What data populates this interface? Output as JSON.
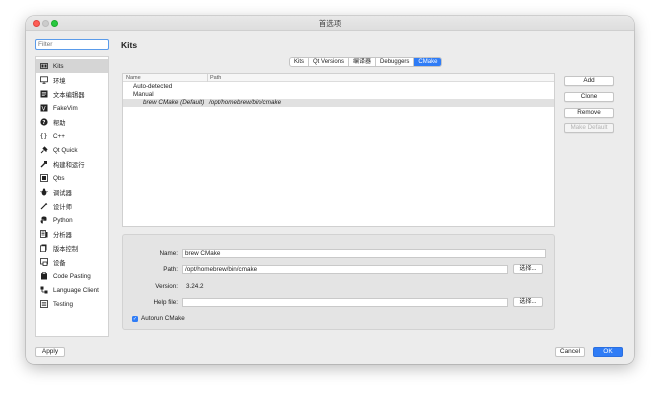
{
  "window": {
    "title": "首选项"
  },
  "filter": {
    "placeholder": "Filter"
  },
  "sidebar": {
    "items": [
      {
        "label": "Kits",
        "icon": "kits-icon"
      },
      {
        "label": "环境",
        "icon": "monitor-icon"
      },
      {
        "label": "文本编辑器",
        "icon": "text-editor-icon"
      },
      {
        "label": "FakeVim",
        "icon": "fakevim-icon"
      },
      {
        "label": "帮助",
        "icon": "help-icon"
      },
      {
        "label": "C++",
        "icon": "braces-icon"
      },
      {
        "label": "Qt Quick",
        "icon": "qt-quick-icon"
      },
      {
        "label": "构建和运行",
        "icon": "build-run-icon"
      },
      {
        "label": "Qbs",
        "icon": "qbs-icon"
      },
      {
        "label": "调试器",
        "icon": "debugger-icon"
      },
      {
        "label": "设计师",
        "icon": "designer-icon"
      },
      {
        "label": "Python",
        "icon": "python-icon"
      },
      {
        "label": "分析器",
        "icon": "analyzer-icon"
      },
      {
        "label": "版本控制",
        "icon": "version-control-icon"
      },
      {
        "label": "设备",
        "icon": "devices-icon"
      },
      {
        "label": "Code Pasting",
        "icon": "code-pasting-icon"
      },
      {
        "label": "Language Client",
        "icon": "language-client-icon"
      },
      {
        "label": "Testing",
        "icon": "testing-icon"
      }
    ],
    "selected_index": 0
  },
  "page": {
    "title": "Kits"
  },
  "tabs": [
    {
      "label": "Kits",
      "active": false
    },
    {
      "label": "Qt Versions",
      "active": false
    },
    {
      "label": "编译器",
      "active": false
    },
    {
      "label": "Debuggers",
      "active": false
    },
    {
      "label": "CMake",
      "active": true
    }
  ],
  "tree": {
    "columns": [
      "Name",
      "Path"
    ],
    "rows": [
      {
        "name": "Auto-detected",
        "path": "",
        "indent": 0,
        "italic": false,
        "selected": false
      },
      {
        "name": "Manual",
        "path": "",
        "indent": 0,
        "italic": false,
        "selected": false
      },
      {
        "name": "brew CMake (Default)",
        "path": "/opt/homebrew/bin/cmake",
        "indent": 1,
        "italic": true,
        "selected": true
      }
    ]
  },
  "actions": {
    "add": "Add",
    "clone": "Clone",
    "remove": "Remove",
    "make_default": "Make Default"
  },
  "details": {
    "name_label": "Name:",
    "name_value": "brew CMake",
    "path_label": "Path:",
    "path_value": "/opt/homebrew/bin/cmake",
    "path_browse": "选择...",
    "version_label": "Version:",
    "version_value": "3.24.2",
    "help_label": "Help file:",
    "help_value": "",
    "help_browse": "选择...",
    "autorun_label": "Autorun CMake",
    "autorun_checked": true
  },
  "footer": {
    "apply": "Apply",
    "cancel": "Cancel",
    "ok": "OK"
  },
  "colors": {
    "accent": "#2f7cf6",
    "close": "#fe5f57",
    "zoom": "#28c840"
  }
}
